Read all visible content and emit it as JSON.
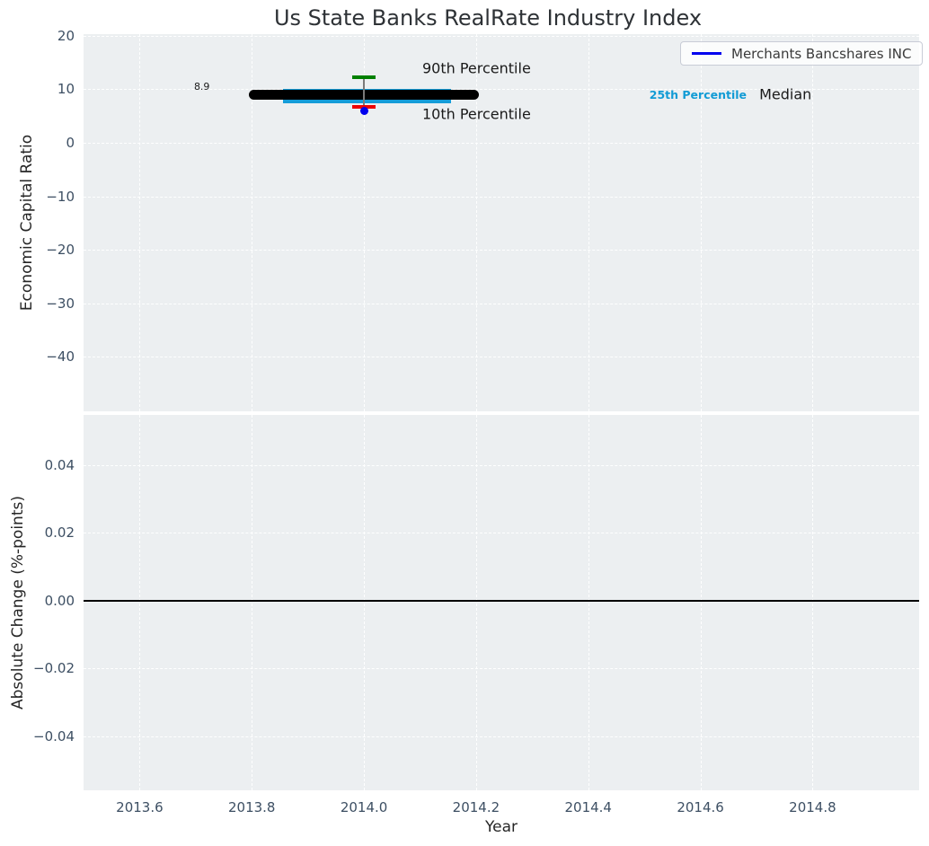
{
  "chart_data": {
    "type": "scatter",
    "title": "Us State Banks RealRate Industry Index",
    "xlabel": "Year",
    "xlim": [
      2013.5,
      2014.99
    ],
    "xticks": {
      "values": [
        2013.6,
        2013.8,
        2014.0,
        2014.2,
        2014.4,
        2014.6,
        2014.8
      ],
      "labels": [
        "2013.6",
        "2013.8",
        "2014.0",
        "2014.2",
        "2014.4",
        "2014.6",
        "2014.8"
      ]
    },
    "grid": true,
    "panels": [
      {
        "name": "industry-index-panel",
        "ylabel": "Economic Capital Ratio",
        "ylim": [
          -50.2,
          20.3
        ],
        "yticks": {
          "values": [
            20,
            10,
            0,
            -10,
            -20,
            -30,
            -40
          ],
          "labels": [
            "20",
            "10",
            "0",
            "−10",
            "−20",
            "−30",
            "−40"
          ]
        },
        "data": {
          "x": 2014.0,
          "median": 8.9,
          "median_x_span": [
            2013.8,
            2014.2
          ],
          "percentile_band": {
            "top": 10.0,
            "bottom": 7.4,
            "x_span": [
              2013.855,
              2014.155
            ]
          },
          "p90": 12.2,
          "p10": 6.7,
          "company_point": {
            "label": "Merchants Bancshares INC",
            "x": 2014.0,
            "y": 5.9
          }
        },
        "annotations": [
          {
            "id": "median-value-label",
            "text": "8.9",
            "x": 2013.711,
            "y": 10.4,
            "align": "center",
            "size": 11,
            "bold": false,
            "color": "#1a1a1a"
          },
          {
            "id": "p90-label",
            "text": "90th Percentile",
            "x": 2014.104,
            "y": 13.75,
            "align": "left",
            "size": 16,
            "bold": false,
            "color": "#1a1a1a"
          },
          {
            "id": "p10-label",
            "text": "10th Percentile",
            "x": 2014.104,
            "y": 5.2,
            "align": "left",
            "size": 16,
            "bold": false,
            "color": "#1a1a1a"
          },
          {
            "id": "p25-label",
            "text": "25th Percentile",
            "x": 2014.509,
            "y": 8.9,
            "align": "left",
            "size": 12.5,
            "bold": true,
            "color": "#119bd5"
          },
          {
            "id": "median-text-label",
            "text": "Median",
            "x": 2014.705,
            "y": 8.9,
            "align": "left",
            "size": 16,
            "bold": false,
            "color": "#1a1a1a"
          }
        ],
        "legend": {
          "position": "upper right",
          "entries": [
            {
              "label": "Merchants Bancshares INC",
              "color": "#0000ee"
            }
          ]
        }
      },
      {
        "name": "absolute-change-panel",
        "ylabel": "Absolute Change (%-points)",
        "ylim": [
          -0.056,
          0.0547
        ],
        "yticks": {
          "values": [
            0.04,
            0.02,
            0.0,
            -0.02,
            -0.04
          ],
          "labels": [
            "0.04",
            "0.02",
            "0.00",
            "−0.02",
            "−0.04"
          ]
        },
        "zero_line": 0.0
      }
    ],
    "colors": {
      "plot_bg": "#eceff1",
      "grid": "#ffffff",
      "tick_label": "#3d4f63",
      "median_line": "#000000",
      "percentile_band": "#159cd8",
      "p90_cap": "#008000",
      "p10_cap": "#ee0000",
      "errorbar_line": "#7a7a7a",
      "company_point": "#0000ee",
      "zero_line": "#000000"
    }
  }
}
